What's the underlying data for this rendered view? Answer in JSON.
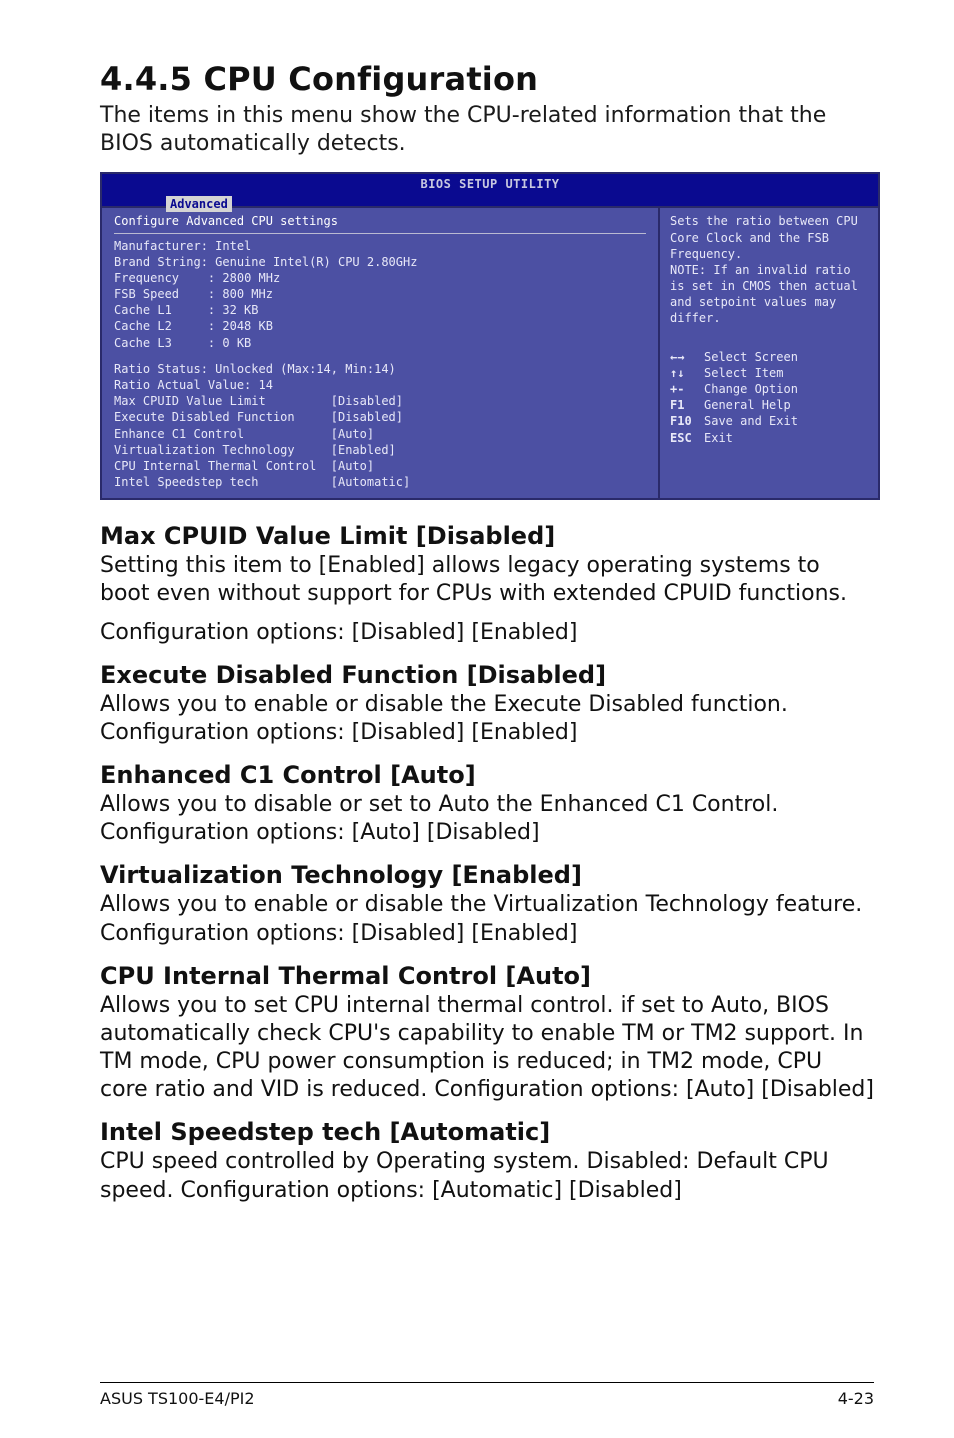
{
  "section": {
    "number_title": "4.4.5 CPU Configuration",
    "intro": "The items in this menu show the CPU-related information that the BIOS automatically detects."
  },
  "bios": {
    "title": "BIOS SETUP UTILITY",
    "tab": "Advanced",
    "heading": "Configure Advanced CPU settings",
    "fields": {
      "manufacturer_label": "Manufacturer:",
      "manufacturer_value": "Intel",
      "brand_label": "Brand String:",
      "brand_value": "Genuine Intel(R) CPU 2.80GHz",
      "frequency_label": "Frequency",
      "frequency_value": "2800 MHz",
      "fsb_label": "FSB Speed",
      "fsb_value": "800 MHz",
      "l1_label": "Cache L1",
      "l1_value": "32 KB",
      "l2_label": "Cache L2",
      "l2_value": "2048 KB",
      "l3_label": "Cache L3",
      "l3_value": "0 KB",
      "ratio_status_label": "Ratio Status:",
      "ratio_status_value": "Unlocked (Max:14, Min:14)",
      "ratio_actual_label": "Ratio Actual Value:",
      "ratio_actual_value": "14"
    },
    "options": [
      {
        "label": "Max CPUID Value Limit",
        "value": "[Disabled]"
      },
      {
        "label": "Execute Disabled Function",
        "value": "[Disabled]"
      },
      {
        "label": "Enhance C1 Control",
        "value": "[Auto]"
      },
      {
        "label": "Virtualization Technology",
        "value": "[Enabled]"
      },
      {
        "label": "CPU Internal Thermal Control",
        "value": "[Auto]"
      },
      {
        "label": "Intel Speedstep tech",
        "value": "[Automatic]"
      }
    ],
    "help_text": "Sets the ratio between CPU Core Clock and the FSB Frequency.\nNOTE: If an invalid ratio is set in CMOS then actual and setpoint values may differ.",
    "nav": [
      {
        "key": "←→",
        "label": "Select Screen"
      },
      {
        "key": "↑↓",
        "label": "Select Item"
      },
      {
        "key": "+-",
        "label": "Change Option"
      },
      {
        "key": "F1",
        "label": "General Help"
      },
      {
        "key": "F10",
        "label": "Save and Exit"
      },
      {
        "key": "ESC",
        "label": "Exit"
      }
    ]
  },
  "doc": [
    {
      "heading": "Max CPUID Value Limit [Disabled]",
      "paras": [
        "Setting this item to [Enabled] allows legacy operating systems to boot even without support for CPUs with extended CPUID functions.",
        "Configuration options: [Disabled] [Enabled]"
      ]
    },
    {
      "heading": "Execute Disabled Function [Disabled]",
      "paras": [
        "Allows you to enable or disable the Execute Disabled function. Configuration options: [Disabled] [Enabled]"
      ]
    },
    {
      "heading": "Enhanced C1 Control [Auto]",
      "paras": [
        "Allows you to disable or set to Auto the Enhanced C1 Control. Configuration options: [Auto] [Disabled]"
      ]
    },
    {
      "heading": "Virtualization Technology [Enabled]",
      "paras": [
        "Allows you to enable or disable the Virtualization Technology feature. Configuration options: [Disabled] [Enabled]"
      ]
    },
    {
      "heading": "CPU Internal Thermal Control [Auto]",
      "paras": [
        "Allows you to set CPU internal thermal control. if set to Auto, BIOS automatically check CPU's capability to enable TM or TM2 support. In TM mode, CPU power consumption is reduced; in TM2 mode, CPU core ratio and VID is reduced. Configuration options: [Auto] [Disabled]"
      ]
    },
    {
      "heading": "Intel Speedstep tech [Automatic]",
      "paras": [
        "CPU speed controlled by Operating system. Disabled: Default CPU speed. Configuration options: [Automatic] [Disabled]"
      ]
    }
  ],
  "footer": {
    "left": "ASUS TS100-E4/PI2",
    "right": "4-23"
  }
}
